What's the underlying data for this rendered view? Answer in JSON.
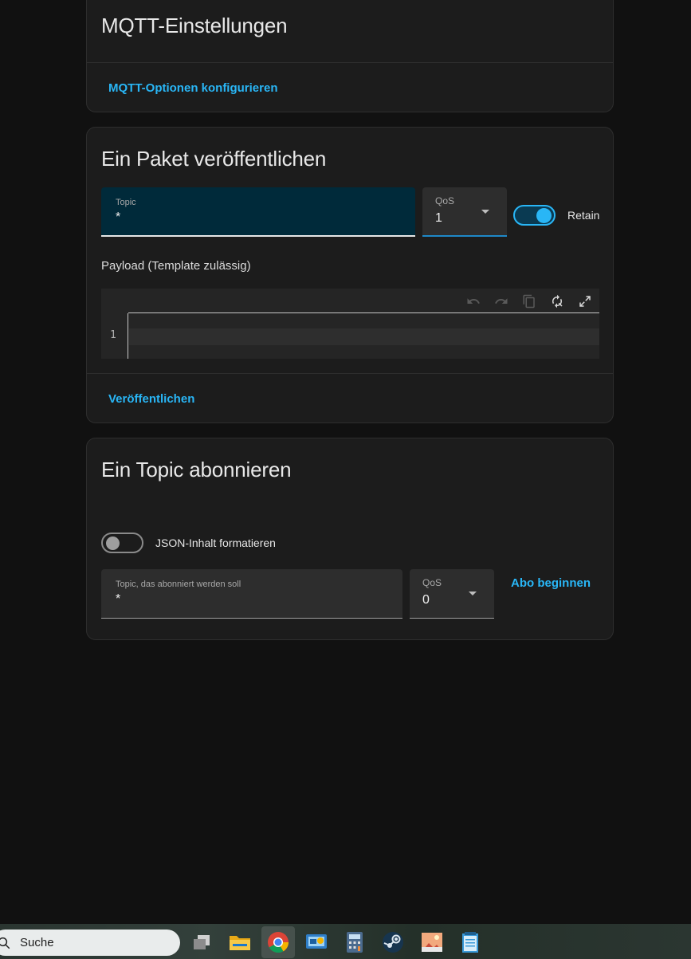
{
  "mqtt_settings": {
    "title": "MQTT-Einstellungen",
    "configure_button": "MQTT-Optionen konfigurieren"
  },
  "publish": {
    "title": "Ein Paket veröffentlichen",
    "topic": {
      "label": "Topic",
      "value": "*"
    },
    "qos": {
      "label": "QoS",
      "value": "1"
    },
    "retain": {
      "label": "Retain",
      "checked": true
    },
    "payload_label": "Payload (Template zulässig)",
    "editor": {
      "line_numbers": [
        "1"
      ]
    },
    "publish_button": "Veröffentlichen"
  },
  "subscribe": {
    "title": "Ein Topic abonnieren",
    "format_json": {
      "label": "JSON-Inhalt formatieren",
      "checked": false
    },
    "topic": {
      "label": "Topic, das abonniert werden soll",
      "value": "*"
    },
    "qos": {
      "label": "QoS",
      "value": "0"
    },
    "subscribe_button": "Abo beginnen"
  },
  "taskbar": {
    "search_label": "Suche",
    "apps": [
      "task-view-icon",
      "file-explorer-icon",
      "chrome-icon",
      "control-panel-icon",
      "calculator-icon",
      "steam-icon",
      "photos-icon",
      "notepad-icon"
    ]
  },
  "colors": {
    "accent": "#29b6f6",
    "background": "#111111",
    "card": "#1c1c1c"
  }
}
